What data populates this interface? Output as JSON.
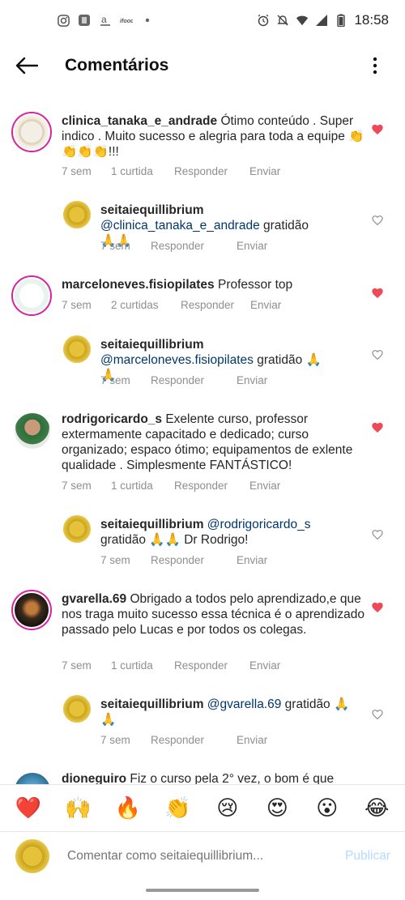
{
  "status_bar": {
    "time": "18:58",
    "left_icons": [
      "instagram-icon",
      "app-icon",
      "amazon-icon",
      "ifood-icon",
      "dot-icon"
    ],
    "right_icons": [
      "alarm-icon",
      "mute-icon",
      "wifi-icon",
      "signal-icon",
      "battery-icon"
    ]
  },
  "header": {
    "title": "Comentários"
  },
  "comments": [
    {
      "username": "clinica_tanaka_e_andrade",
      "text": " Ótimo conteúdo . Super indico . Muito sucesso e alegria para toda a equipe 👏👏👏👏!!!",
      "time": "7 sem",
      "likes": "1 curtida",
      "reply_label": "Responder",
      "send_label": "Enviar",
      "liked": true
    },
    {
      "username": "seitaiequillibrium",
      "mention": "@clinica_tanaka_e_andrade",
      "text": " gratidão 🙏🙏",
      "time": "7 sem",
      "reply_label": "Responder",
      "send_label": "Enviar",
      "liked": false
    },
    {
      "username": "marceloneves.fisiopilates",
      "text": " Professor top",
      "time": "7 sem",
      "likes": "2 curtidas",
      "reply_label": "Responder",
      "send_label": "Enviar",
      "liked": true
    },
    {
      "username": "seitaiequillibrium",
      "mention": "@marceloneves.fisiopilates",
      "text": " gratidão 🙏🙏",
      "time": "7 sem",
      "reply_label": "Responder",
      "send_label": "Enviar",
      "liked": false
    },
    {
      "username": "rodrigoricardo_s",
      "text": " Exelente curso, professor extermamente capacitado e dedicado; curso organizado; espaco ótimo; equipamentos de exlente qualidade . Simplesmente FANTÁSTICO!",
      "time": "7 sem",
      "likes": "1 curtida",
      "reply_label": "Responder",
      "send_label": "Enviar",
      "liked": true
    },
    {
      "username": "seitaiequillibrium",
      "mention": "@rodrigoricardo_s",
      "text": " gratidão 🙏🙏 Dr Rodrigo!",
      "time": "7 sem",
      "reply_label": "Responder",
      "send_label": "Enviar",
      "liked": false
    },
    {
      "username": "gvarella.69",
      "text": " Obrigado a todos pelo aprendizado,e que nos traga muito sucesso essa técnica é o aprendizado passado pelo Lucas e por todos os colegas.",
      "time": "7 sem",
      "likes": "1 curtida",
      "reply_label": "Responder",
      "send_label": "Enviar",
      "liked": true
    },
    {
      "username": "seitaiequillibrium",
      "mention": "@gvarella.69",
      "text": " gratidão 🙏🙏",
      "time": "7 sem",
      "reply_label": "Responder",
      "send_label": "Enviar",
      "liked": false
    },
    {
      "username": "dioneguiro",
      "text": " Fiz o curso pela 2° vez, o bom é que"
    }
  ],
  "emoji_bar": [
    "❤️",
    "🙌",
    "🔥",
    "👏",
    "😢",
    "😍",
    "😮",
    "😂"
  ],
  "composer": {
    "placeholder": "Comentar como seitaiequillibrium...",
    "publish_label": "Publicar"
  },
  "colors": {
    "like_red": "#ed4956",
    "mention_blue": "#00376b",
    "publish_disabled": "#b3dbff",
    "meta_gray": "#8e8e8e"
  }
}
